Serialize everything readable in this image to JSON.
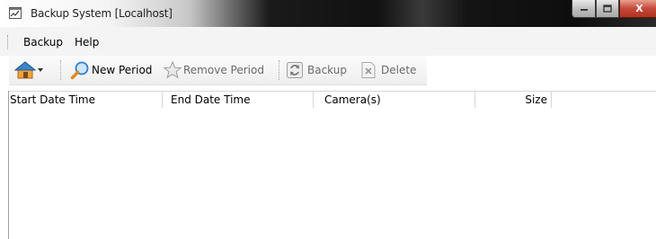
{
  "window": {
    "title": "Backup System [Localhost]",
    "app_icon": "app-window-icon",
    "controls": {
      "minimize": "minimize-icon",
      "maximize": "maximize-icon",
      "close": "close-icon",
      "close_glyph": "X"
    }
  },
  "menu": {
    "items": [
      {
        "label": "Backup"
      },
      {
        "label": "Help"
      }
    ]
  },
  "toolbar": {
    "home_icon": "home-icon",
    "dropdown_icon": "chevron-down-icon",
    "new_period": {
      "label": "New Period",
      "icon": "magnifier-icon",
      "enabled": true
    },
    "remove_period": {
      "label": "Remove Period",
      "icon": "star-icon",
      "enabled": false
    },
    "backup": {
      "label": "Backup",
      "icon": "refresh-icon",
      "enabled": false
    },
    "delete": {
      "label": "Delete",
      "icon": "delete-icon",
      "enabled": false
    }
  },
  "table": {
    "columns": [
      "Start Date Time",
      "End Date Time",
      "Camera(s)",
      "Size"
    ],
    "rows": []
  }
}
